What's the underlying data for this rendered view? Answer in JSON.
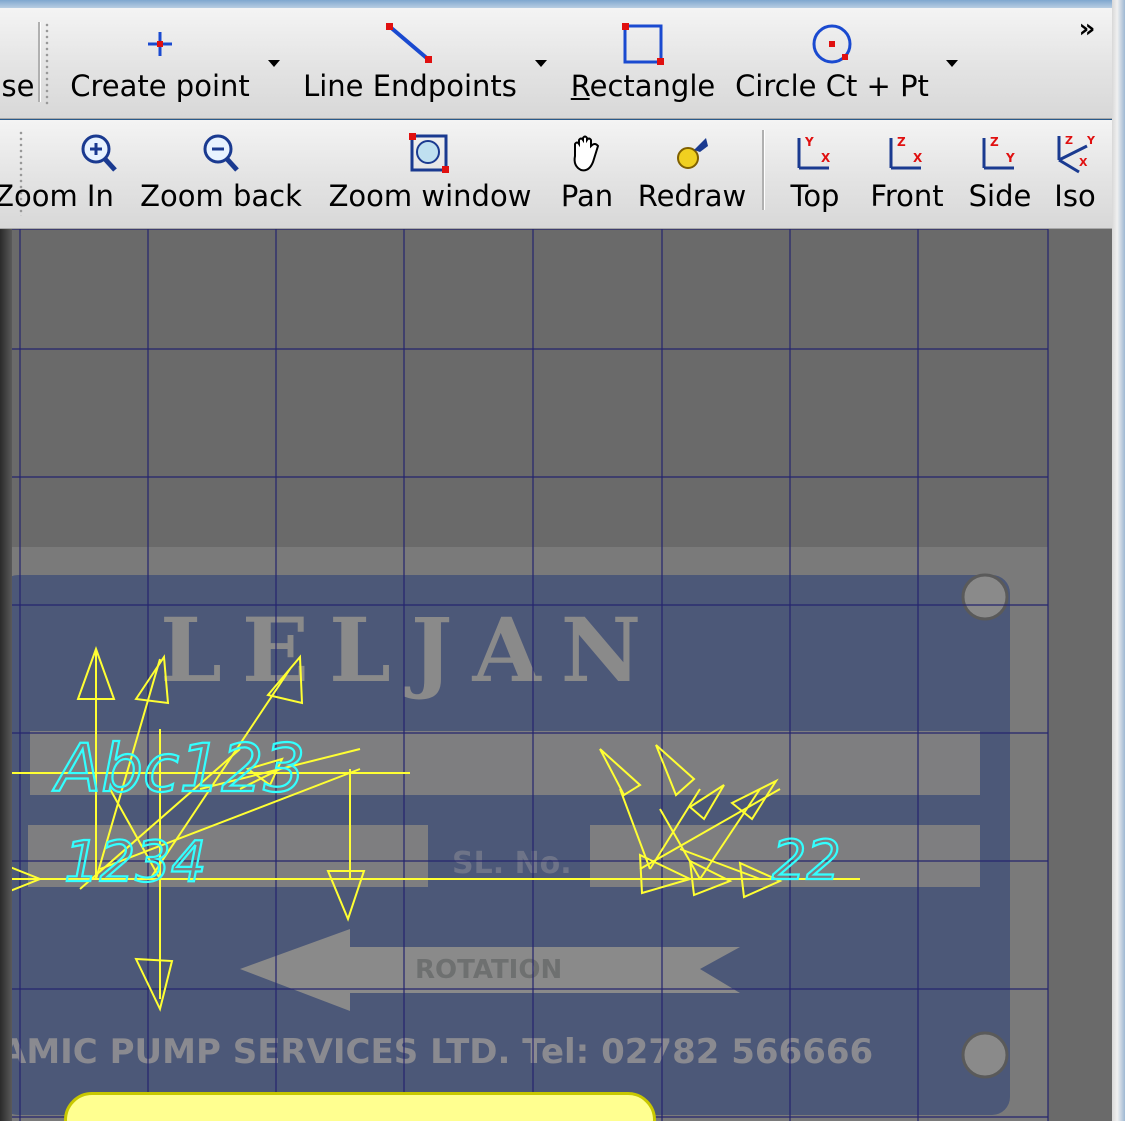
{
  "toolbar_top": {
    "cut_label": "se",
    "create_point": "Create point",
    "line_endpoints": "Line Endpoints",
    "rectangle_prefix": "R",
    "rectangle_rest": "ectangle",
    "circle": "Circle Ct + Pt",
    "overflow": "»"
  },
  "toolbar_view": {
    "zoom_in": "Zoom In",
    "zoom_back": "Zoom back",
    "zoom_window": "Zoom window",
    "pan": "Pan",
    "redraw": "Redraw",
    "top": "Top",
    "front": "Front",
    "side": "Side",
    "iso": "Iso"
  },
  "plate": {
    "brand": "LELJAN",
    "sl_no": "SL. No.",
    "rotation": "ROTATION",
    "footer": "AMIC PUMP SERVICES LTD.   Tel: 02782 566666"
  },
  "cad_text": {
    "line1": "Abc123",
    "line2": "1234",
    "line3": "22"
  },
  "colors": {
    "grid": "#24246e",
    "geometry": "#ffff33",
    "text": "#33ffff",
    "plate": "#4a5a7a"
  },
  "icons": [
    "plus-icon",
    "line-icon",
    "rectangle-icon",
    "circle-icon",
    "zoom-in-icon",
    "zoom-out-icon",
    "zoom-window-icon",
    "hand-icon",
    "redraw-icon",
    "top-view-icon",
    "front-view-icon",
    "side-view-icon",
    "iso-view-icon"
  ]
}
